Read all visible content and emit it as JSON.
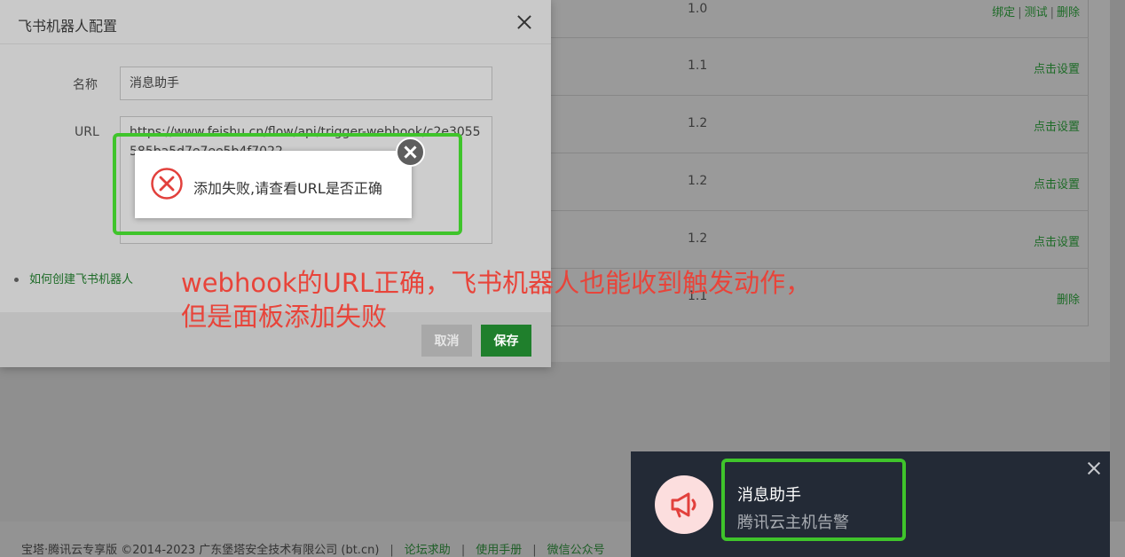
{
  "background": {
    "rows": [
      {
        "version": "1.0",
        "ops": [
          "绑定",
          "测试",
          "删除"
        ]
      },
      {
        "version": "1.1",
        "ops": [
          "点击设置"
        ]
      },
      {
        "version": "1.2",
        "ops": [
          "点击设置"
        ]
      },
      {
        "version": "1.2",
        "ops": [
          "点击设置"
        ]
      },
      {
        "version": "1.2",
        "ops": [
          "点击设置"
        ]
      },
      {
        "version": "1.1",
        "ops": [
          "删除"
        ]
      }
    ]
  },
  "dialog": {
    "title": "飞书机器人配置",
    "name_label": "名称",
    "name_value": "消息助手",
    "url_label": "URL",
    "url_value": "https://www.feishu.cn/flow/api/trigger-webhook/c2e3055585ba5d7e7ee5b4f7022",
    "help_link": "如何创建飞书机器人",
    "cancel_label": "取消",
    "save_label": "保存"
  },
  "error_toast": {
    "message": "添加失败,请查看URL是否正确"
  },
  "annotation": {
    "line1": "webhook的URL正确，飞书机器人也能收到触发动作，",
    "line2": "但是面板添加失败"
  },
  "notification": {
    "title": "消息助手",
    "body": "腾讯云主机告警"
  },
  "footer": {
    "copyright": "宝塔·腾讯云专享版 ©2014-2023 广东堡塔安全技术有限公司 (bt.cn)",
    "links": [
      "论坛求助",
      "使用手册",
      "微信公众号"
    ]
  },
  "colors": {
    "accent_green": "#1f7f2c",
    "highlight_green": "#3fc42b",
    "annotation_red": "#e8443a",
    "error_red": "#e2403c"
  }
}
